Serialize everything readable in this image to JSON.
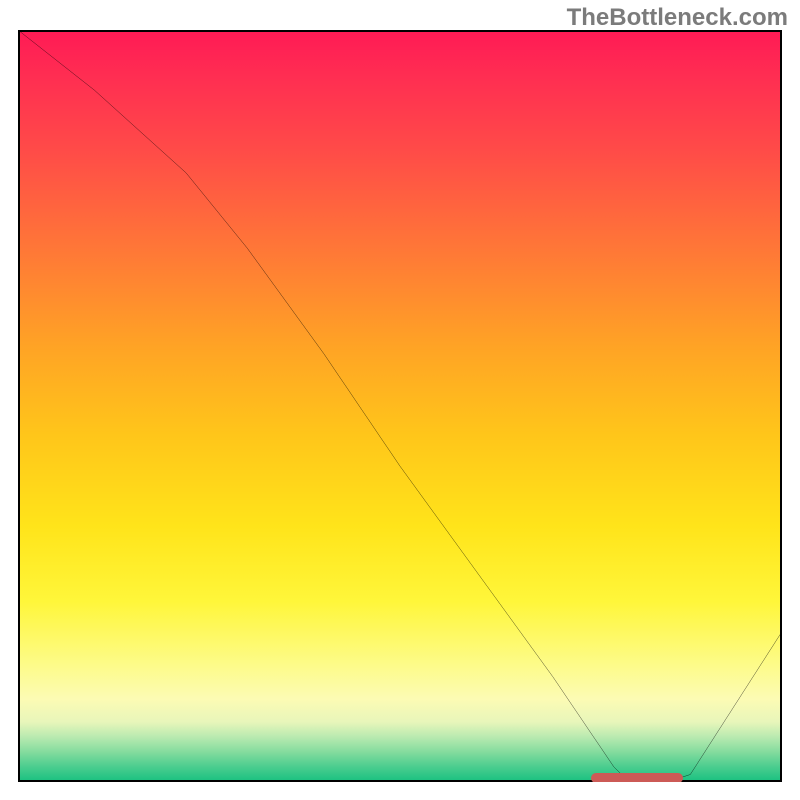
{
  "watermark": "TheBottleneck.com",
  "chart_data": {
    "type": "line",
    "title": "",
    "xlabel": "",
    "ylabel": "",
    "xlim": [
      0,
      100
    ],
    "ylim": [
      0,
      100
    ],
    "grid": false,
    "legend": false,
    "series": [
      {
        "name": "curve",
        "x": [
          0,
          10,
          22,
          30,
          40,
          50,
          60,
          70,
          78,
          80,
          85,
          88,
          100
        ],
        "values": [
          100,
          92,
          81,
          71,
          57,
          42,
          28,
          14,
          2,
          0,
          0,
          1,
          20
        ]
      }
    ],
    "minimum_marker": {
      "x_start": 75,
      "x_end": 87,
      "y": 0.5,
      "color": "#cc5a56"
    },
    "gradient_stops": [
      {
        "pct": 0,
        "color": "#ff1a55"
      },
      {
        "pct": 30,
        "color": "#ff7a36"
      },
      {
        "pct": 66,
        "color": "#ffe41a"
      },
      {
        "pct": 89,
        "color": "#fcfbb4"
      },
      {
        "pct": 100,
        "color": "#17c07f"
      }
    ]
  }
}
